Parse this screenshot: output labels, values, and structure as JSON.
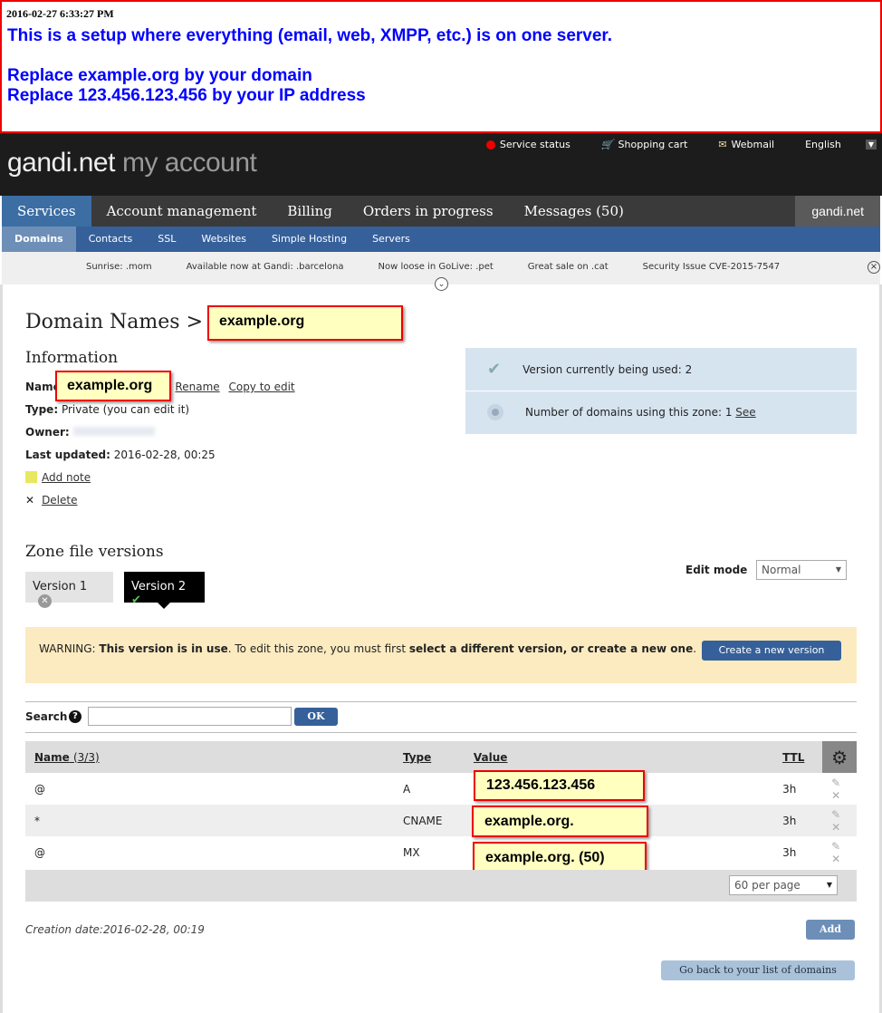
{
  "annotation": {
    "timestamp": "2016-02-27 6:33:27 PM",
    "line1": "This is a setup where everything (email, web, XMPP, etc.) is on one server.",
    "line2": "Replace example.org by your domain",
    "line3": "Replace 123.456.123.456 by your IP address"
  },
  "header": {
    "logo": "gandi.net",
    "logo_sub": "my account",
    "links": [
      "Service status",
      "Shopping cart",
      "Webmail",
      "English"
    ]
  },
  "nav": {
    "tabs": [
      "Services",
      "Account management",
      "Billing",
      "Orders in progress",
      "Messages (50)"
    ],
    "brand": "gandi.net"
  },
  "subnav": [
    "Domains",
    "Contacts",
    "SSL",
    "Websites",
    "Simple Hosting",
    "Servers"
  ],
  "ticker": [
    "Sunrise: .mom",
    "Available now at Gandi: .barcelona",
    "Now loose in GoLive: .pet",
    "Great sale on .cat",
    "Security Issue CVE-2015-7547"
  ],
  "page": {
    "title": "Domain Names >",
    "domain": "example.org"
  },
  "info": {
    "heading": "Information",
    "name_label": "Name:",
    "name_value": "example.org",
    "rename": "Rename",
    "copy": "Copy to edit",
    "type_label": "Type:",
    "type_value": "Private (you can edit it)",
    "owner_label": "Owner:",
    "updated_label": "Last updated:",
    "updated_value": "2016-02-28, 00:25",
    "add_note": "Add note",
    "delete": "Delete"
  },
  "version_box": {
    "current": "Version currently being used: 2",
    "domains": "Number of domains using this zone: 1",
    "see": "See"
  },
  "zone": {
    "heading": "Zone file versions",
    "versions": [
      "Version 1",
      "Version 2"
    ],
    "edit_mode_label": "Edit mode",
    "edit_mode": "Normal"
  },
  "warning": {
    "prefix": "WARNING: ",
    "bold1": "This version is in use",
    "mid": ". To edit this zone, you must first ",
    "bold2": "select a different version, or create a new one",
    "end": ".",
    "button": "Create a new version"
  },
  "search": {
    "label": "Search",
    "button": "OK",
    "value": ""
  },
  "records": {
    "headers": [
      "Name",
      "(3/3)",
      "Type",
      "Value",
      "TTL"
    ],
    "rows": [
      {
        "name": "@",
        "type": "A",
        "value": "123.456.123.456",
        "ttl": "3h"
      },
      {
        "name": "*",
        "type": "CNAME",
        "value": "example.org.",
        "ttl": "3h"
      },
      {
        "name": "@",
        "type": "MX",
        "value": "example.org. (50)",
        "ttl": "3h"
      }
    ],
    "per_page": "60 per page"
  },
  "footer": {
    "creation": "Creation date:2016-02-28, 00:19",
    "add": "Add",
    "back": "Go back to your list of domains"
  }
}
